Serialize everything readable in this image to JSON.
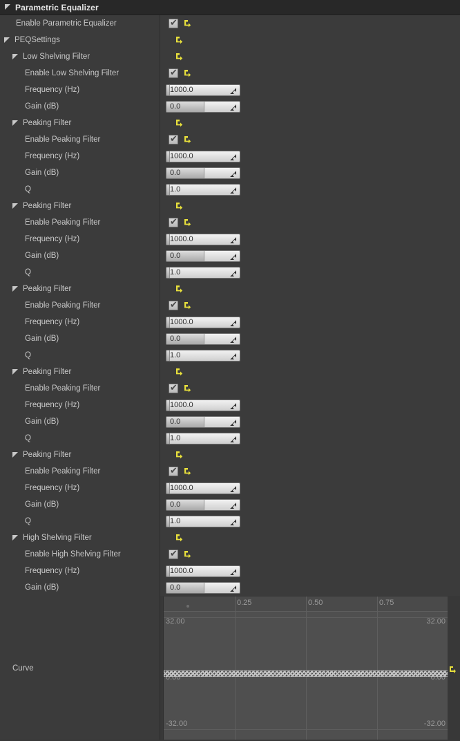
{
  "panel": {
    "title": "Parametric Equalizer",
    "expander_icon": "triangle-down-icon",
    "reset_icon": "reset-to-default-icon",
    "checkbox_glyph": "✔",
    "colors": {
      "panel_bg": "#383838",
      "row_bg": "#3b3b3b",
      "header_bg": "#282828",
      "label_text": "#c8c8c8",
      "title_text": "#e6e6e6",
      "reset_yellow": "#e8e03c",
      "spin_text": "#303030",
      "graph_bg": "#4f4f4f",
      "graph_grid": "#5e5e5e",
      "graph_text": "#9a9a9a"
    }
  },
  "rows": [
    {
      "id": "enable-parametric-equalizer",
      "label": "Enable Parametric Equalizer",
      "indent": "leaf1",
      "expander": false,
      "control": "checkbox",
      "checked": true,
      "reset": true
    },
    {
      "id": "peqsettings",
      "label": "PEQSettings",
      "indent": "ind1",
      "expander": true,
      "control": "none",
      "reset": true
    },
    {
      "id": "low-shelving-filter",
      "label": "Low Shelving Filter",
      "indent": "ind2",
      "expander": true,
      "control": "none",
      "reset": true
    },
    {
      "id": "enable-low-shelving-filter",
      "label": "Enable Low Shelving Filter",
      "indent": "leaf2",
      "expander": false,
      "control": "checkbox",
      "checked": true,
      "reset": true
    },
    {
      "id": "low-shelving-frequency",
      "label": "Frequency (Hz)",
      "indent": "leaf2",
      "expander": false,
      "control": "spin",
      "value": "1000.0",
      "fill": 5
    },
    {
      "id": "low-shelving-gain",
      "label": "Gain (dB)",
      "indent": "leaf2",
      "expander": false,
      "control": "spin",
      "value": "0.0",
      "fill": 52
    },
    {
      "id": "peaking-filter-1",
      "label": "Peaking Filter",
      "indent": "ind2",
      "expander": true,
      "control": "none",
      "reset": true
    },
    {
      "id": "enable-peaking-filter-1",
      "label": "Enable Peaking Filter",
      "indent": "leaf2",
      "expander": false,
      "control": "checkbox",
      "checked": true,
      "reset": true
    },
    {
      "id": "peaking-1-frequency",
      "label": "Frequency (Hz)",
      "indent": "leaf2",
      "expander": false,
      "control": "spin",
      "value": "1000.0",
      "fill": 5
    },
    {
      "id": "peaking-1-gain",
      "label": "Gain (dB)",
      "indent": "leaf2",
      "expander": false,
      "control": "spin",
      "value": "0.0",
      "fill": 52
    },
    {
      "id": "peaking-1-q",
      "label": "Q",
      "indent": "leaf2",
      "expander": false,
      "control": "spin",
      "value": "1.0",
      "fill": 5
    },
    {
      "id": "peaking-filter-2",
      "label": "Peaking Filter",
      "indent": "ind2",
      "expander": true,
      "control": "none",
      "reset": true
    },
    {
      "id": "enable-peaking-filter-2",
      "label": "Enable Peaking Filter",
      "indent": "leaf2",
      "expander": false,
      "control": "checkbox",
      "checked": true,
      "reset": true
    },
    {
      "id": "peaking-2-frequency",
      "label": "Frequency (Hz)",
      "indent": "leaf2",
      "expander": false,
      "control": "spin",
      "value": "1000.0",
      "fill": 5
    },
    {
      "id": "peaking-2-gain",
      "label": "Gain (dB)",
      "indent": "leaf2",
      "expander": false,
      "control": "spin",
      "value": "0.0",
      "fill": 52
    },
    {
      "id": "peaking-2-q",
      "label": "Q",
      "indent": "leaf2",
      "expander": false,
      "control": "spin",
      "value": "1.0",
      "fill": 5
    },
    {
      "id": "peaking-filter-3",
      "label": "Peaking Filter",
      "indent": "ind2",
      "expander": true,
      "control": "none",
      "reset": true
    },
    {
      "id": "enable-peaking-filter-3",
      "label": "Enable Peaking Filter",
      "indent": "leaf2",
      "expander": false,
      "control": "checkbox",
      "checked": true,
      "reset": true
    },
    {
      "id": "peaking-3-frequency",
      "label": "Frequency (Hz)",
      "indent": "leaf2",
      "expander": false,
      "control": "spin",
      "value": "1000.0",
      "fill": 5
    },
    {
      "id": "peaking-3-gain",
      "label": "Gain (dB)",
      "indent": "leaf2",
      "expander": false,
      "control": "spin",
      "value": "0.0",
      "fill": 52
    },
    {
      "id": "peaking-3-q",
      "label": "Q",
      "indent": "leaf2",
      "expander": false,
      "control": "spin",
      "value": "1.0",
      "fill": 5
    },
    {
      "id": "peaking-filter-4",
      "label": "Peaking Filter",
      "indent": "ind2",
      "expander": true,
      "control": "none",
      "reset": true
    },
    {
      "id": "enable-peaking-filter-4",
      "label": "Enable Peaking Filter",
      "indent": "leaf2",
      "expander": false,
      "control": "checkbox",
      "checked": true,
      "reset": true
    },
    {
      "id": "peaking-4-frequency",
      "label": "Frequency (Hz)",
      "indent": "leaf2",
      "expander": false,
      "control": "spin",
      "value": "1000.0",
      "fill": 5
    },
    {
      "id": "peaking-4-gain",
      "label": "Gain (dB)",
      "indent": "leaf2",
      "expander": false,
      "control": "spin",
      "value": "0.0",
      "fill": 52
    },
    {
      "id": "peaking-4-q",
      "label": "Q",
      "indent": "leaf2",
      "expander": false,
      "control": "spin",
      "value": "1.0",
      "fill": 5
    },
    {
      "id": "peaking-filter-5",
      "label": "Peaking Filter",
      "indent": "ind2",
      "expander": true,
      "control": "none",
      "reset": true
    },
    {
      "id": "enable-peaking-filter-5",
      "label": "Enable Peaking Filter",
      "indent": "leaf2",
      "expander": false,
      "control": "checkbox",
      "checked": true,
      "reset": true
    },
    {
      "id": "peaking-5-frequency",
      "label": "Frequency (Hz)",
      "indent": "leaf2",
      "expander": false,
      "control": "spin",
      "value": "1000.0",
      "fill": 5
    },
    {
      "id": "peaking-5-gain",
      "label": "Gain (dB)",
      "indent": "leaf2",
      "expander": false,
      "control": "spin",
      "value": "0.0",
      "fill": 52
    },
    {
      "id": "peaking-5-q",
      "label": "Q",
      "indent": "leaf2",
      "expander": false,
      "control": "spin",
      "value": "1.0",
      "fill": 5
    },
    {
      "id": "high-shelving-filter",
      "label": "High Shelving Filter",
      "indent": "ind2",
      "expander": true,
      "control": "none",
      "reset": true
    },
    {
      "id": "enable-high-shelving-filter",
      "label": "Enable High Shelving Filter",
      "indent": "leaf2",
      "expander": false,
      "control": "checkbox",
      "checked": true,
      "reset": true
    },
    {
      "id": "high-shelving-frequency",
      "label": "Frequency (Hz)",
      "indent": "leaf2",
      "expander": false,
      "control": "spin",
      "value": "1000.0",
      "fill": 5
    },
    {
      "id": "high-shelving-gain",
      "label": "Gain (dB)",
      "indent": "leaf2",
      "expander": false,
      "control": "spin",
      "value": "0.0",
      "fill": 52
    }
  ],
  "curve": {
    "label": "Curve",
    "reset_icon": "reset-to-default-icon",
    "chart_data": {
      "type": "line",
      "title": "Curve",
      "xlabel": "",
      "ylabel": "",
      "x_ticks": [
        "0.25",
        "0.50",
        "0.75"
      ],
      "x_tick_values": [
        0.25,
        0.5,
        0.75
      ],
      "xlim": [
        0,
        1
      ],
      "ylim": [
        -32,
        32
      ],
      "y_labels_left": [
        "32.00",
        "0.00",
        "-32.00"
      ],
      "y_labels_right": [
        "32.00",
        "0.00",
        "-32.00"
      ],
      "y_tick_values": [
        32,
        0,
        -32
      ],
      "grid": true,
      "legend": "none",
      "series": [
        {
          "name": "Curve",
          "x": [
            0,
            0.25,
            0.5,
            0.75,
            1.0
          ],
          "values": [
            0,
            0,
            0,
            0,
            0
          ]
        }
      ]
    }
  }
}
